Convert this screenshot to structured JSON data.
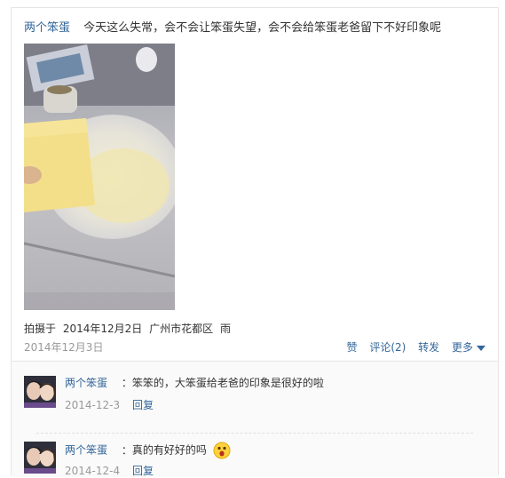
{
  "post": {
    "author": "两个笨蛋",
    "text": "今天这么失常，会不会让笨蛋失望，会不会给笨蛋老爸留下不好印象呢",
    "photo_meta": {
      "prefix": "拍摄于",
      "date": "2014年12月2日",
      "location": "广州市花都区",
      "weather": "雨"
    },
    "date": "2014年12月3日",
    "actions": {
      "like": "赞",
      "comment": "评论(2)",
      "share": "转发",
      "more": "更多"
    }
  },
  "comments": [
    {
      "author": "两个笨蛋",
      "separator": "：",
      "text": "笨笨的，大笨蛋给老爸的印象是很好的啦",
      "date": "2014-12-3",
      "reply": "回复",
      "emoji": null
    },
    {
      "author": "两个笨蛋",
      "separator": "：",
      "text": "真的有好好的吗",
      "date": "2014-12-4",
      "reply": "回复",
      "emoji": "surprised-face"
    }
  ],
  "colors": {
    "link": "#336699",
    "muted": "#999999",
    "text": "#333333",
    "border": "#e6e6e6"
  }
}
